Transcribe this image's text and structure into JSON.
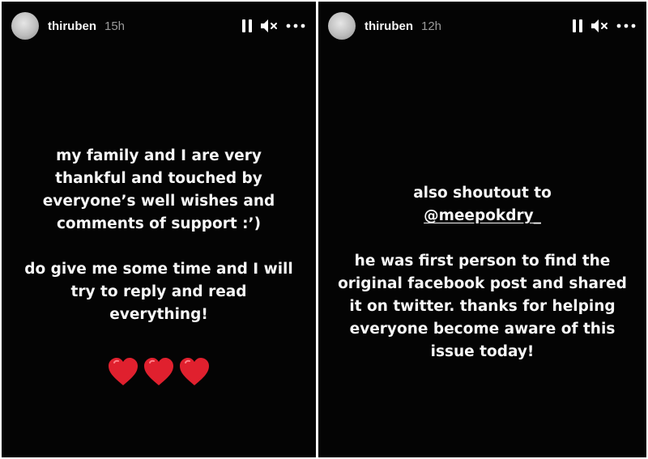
{
  "left_story": {
    "username": "thiruben",
    "time": "15h",
    "paragraph1": "my family and I are very thankful and touched by everyone’s well wishes and comments of support :’)",
    "paragraph2": "do give me some time and I will try to reply and read everything!",
    "hearts": [
      "❤",
      "❤",
      "❤"
    ]
  },
  "right_story": {
    "username": "thiruben",
    "time": "12h",
    "line1": "also shoutout to",
    "mention": "@meepokdry_",
    "paragraph2": "he was first person to find the original facebook post and shared it on twitter. thanks for helping everyone become aware of this issue today!"
  },
  "icons": {
    "pause": "pause-icon",
    "mute": "speaker-muted-icon",
    "more": "more-options-icon",
    "heart": "red-heart-icon"
  },
  "colors": {
    "background": "#040404",
    "text": "#f7f7f7",
    "timestamp": "#9a9a9a",
    "heart": "#e0202e"
  }
}
